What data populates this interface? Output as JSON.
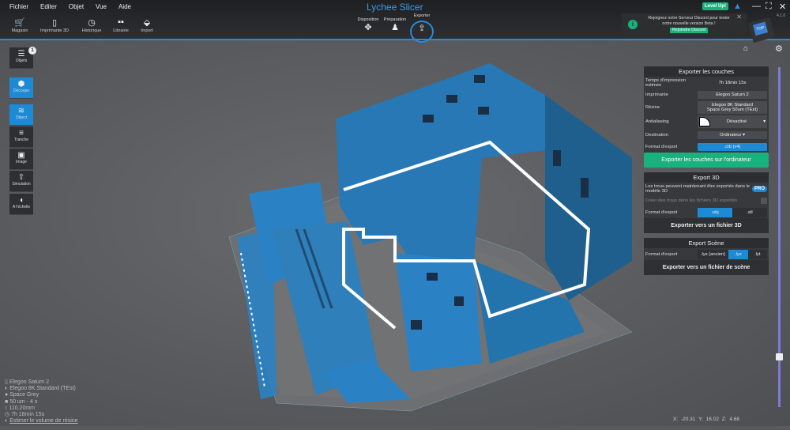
{
  "app": {
    "title": "Lychee Slicer",
    "version": "4.1.0"
  },
  "menu": [
    "Fichier",
    "Editer",
    "Objet",
    "Vue",
    "Aide"
  ],
  "toolbar": [
    {
      "label": "Magasin",
      "icon": "cart-icon"
    },
    {
      "label": "Imprimante 3D",
      "icon": "phone-icon"
    },
    {
      "label": "Historique",
      "icon": "history-icon"
    },
    {
      "label": "Librairie",
      "icon": "library-icon"
    },
    {
      "label": "Import",
      "icon": "import-icon"
    }
  ],
  "modes": [
    {
      "label": "Disposition"
    },
    {
      "label": "Préparation"
    },
    {
      "label": "Exporter",
      "active": true
    }
  ],
  "level_up": "Level Up!",
  "notification": {
    "text": "Rejoignez notre Serveur Discord pour tester notre nouvelle version Beta !",
    "button": "Rejoindre Discord"
  },
  "cube_label": "TOP",
  "left_tools": {
    "objects": "Objets",
    "objects_badge": "1",
    "decoupe": "Découpe",
    "object": "Object",
    "tranche": "Tranche",
    "image": "Image",
    "simulation": "Simulation",
    "scale": "A l'échelle"
  },
  "export_layers": {
    "title": "Exporter les couches",
    "time_label": "Temps d'impression estimée",
    "time_value": "7h 18min 15s",
    "printer_label": "Imprimante",
    "printer_value": "Elegoo Saturn 2",
    "resin_label": "Résine",
    "resin_value_1": "Elegoo 8K Standard",
    "resin_value_2": "Space Grey 50um   (TEst)",
    "aa_label": "Antialiasing",
    "aa_value": "Désactivé",
    "dest_label": "Destination",
    "dest_value": "Ordinateur",
    "format_label": "Format d'export",
    "format_value": ".ctb (v4)",
    "button": "Exporter les couches sur l'ordinateur"
  },
  "export_3d": {
    "title": "Export 3D",
    "info": "Les trous peuvent maintenant être exportés dans le modèle 3D",
    "pro": "PRO",
    "holes_label": "Créer des trous dans les fichiers 3D exportés",
    "format_label": "Format d'export",
    "formats": [
      ".obj",
      ".stl"
    ],
    "selected": ".obj",
    "button": "Exporter vers un fichier 3D"
  },
  "export_scene": {
    "title": "Export Scène",
    "format_label": "Format d'export",
    "formats": [
      ".lys (ancien)",
      ".lys",
      ".lyt"
    ],
    "selected": ".lys",
    "button": "Exporter vers un fichier de scène"
  },
  "status": [
    "Elegoo Saturn 2",
    "Elegoo 8K Standard (TEst)",
    "Space Grey",
    "50 um - 4 s",
    "110.20mm",
    "7h 18min 15s"
  ],
  "status_link": "Estimer le volume de résine",
  "coords": {
    "x": "X: -20.31",
    "y": "Y: 16.02",
    "z": "Z: 4.68"
  },
  "colors": {
    "accent": "#1d8ad6",
    "green": "#18b27d",
    "model": "#2a82c4"
  }
}
